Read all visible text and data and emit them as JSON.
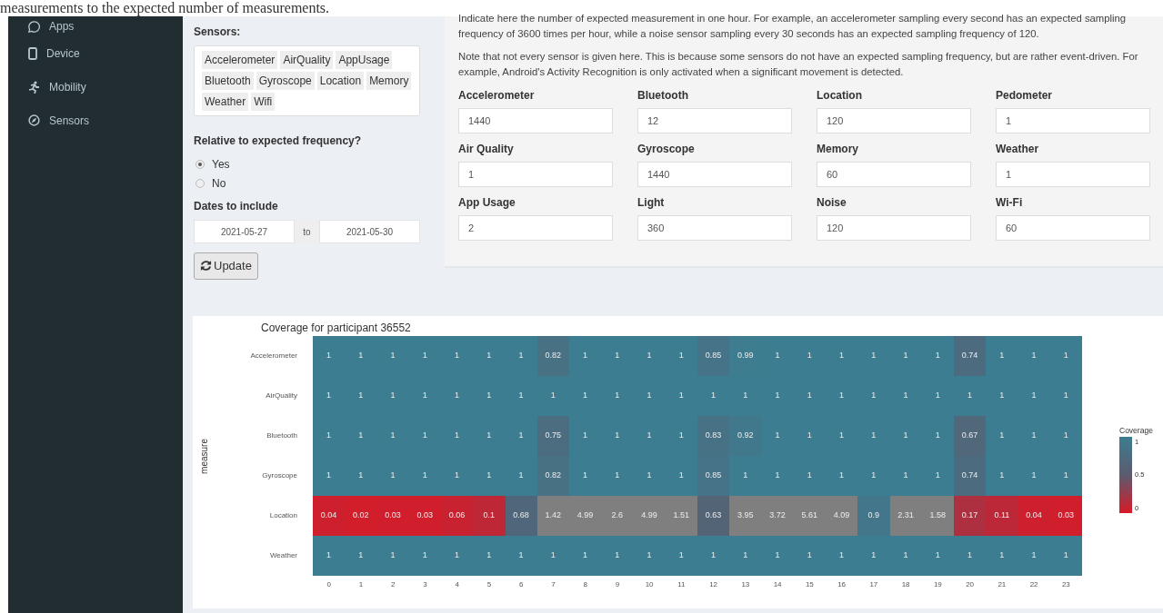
{
  "top_text": "measurements to the expected number of measurements.",
  "sidebar": {
    "items": [
      {
        "label": "Apps"
      },
      {
        "label": "Device"
      },
      {
        "label": "Mobility"
      },
      {
        "label": "Sensors"
      }
    ]
  },
  "filters": {
    "sensors_label": "Sensors:",
    "sensors": [
      "Accelerometer",
      "AirQuality",
      "AppUsage",
      "Bluetooth",
      "Gyroscope",
      "Location",
      "Memory",
      "Weather",
      "Wifi"
    ],
    "relative_label": "Relative to expected frequency?",
    "relative_options": [
      {
        "label": "Yes",
        "selected": true
      },
      {
        "label": "No",
        "selected": false
      }
    ],
    "dates_label": "Dates to include",
    "date_start": "2021-05-27",
    "date_separator": "to",
    "date_end": "2021-05-30",
    "update_button": "Update"
  },
  "frequency": {
    "paragraphs": [
      "Indicate here the number of expected measurement in one hour. For example, an accelerometer sampling every second has an expected sampling frequency of 3600 times per hour, while a noise sensor sampling every 30 seconds has an expected sampling frequency of 120.",
      "Note that not every sensor is given here. This is because some sensors do not have an expected sampling frequency, but are rather event-driven. For example, Android's Activity Recognition is only activated when a significant movement is detected."
    ],
    "fields": [
      {
        "label": "Accelerometer",
        "value": "1440"
      },
      {
        "label": "Bluetooth",
        "value": "12"
      },
      {
        "label": "Location",
        "value": "120"
      },
      {
        "label": "Pedometer",
        "value": "1"
      },
      {
        "label": "Air Quality",
        "value": "1"
      },
      {
        "label": "Gyroscope",
        "value": "1440"
      },
      {
        "label": "Memory",
        "value": "60"
      },
      {
        "label": "Weather",
        "value": "1"
      },
      {
        "label": "App Usage",
        "value": "2"
      },
      {
        "label": "Light",
        "value": "360"
      },
      {
        "label": "Noise",
        "value": "120"
      },
      {
        "label": "Wi-Fi",
        "value": "60"
      }
    ]
  },
  "heatmap": {
    "title": "Coverage for participant 36552",
    "ylabel": "measure",
    "legend_title": "Coverage",
    "legend_ticks": [
      "1",
      "0.5",
      "0"
    ],
    "x_axis_ticks": [
      "0",
      "1",
      "2",
      "3",
      "4",
      "5",
      "6",
      "7",
      "8",
      "9",
      "10",
      "11",
      "12",
      "13",
      "14",
      "15",
      "16",
      "17",
      "18",
      "19",
      "20",
      "21",
      "22",
      "23"
    ],
    "rows": [
      {
        "label": "Accelerometer",
        "cells": [
          "1",
          "1",
          "1",
          "1",
          "1",
          "1",
          "1",
          "0.82",
          "1",
          "1",
          "1",
          "1",
          "0.85",
          "0.99",
          "1",
          "1",
          "1",
          "1",
          "1",
          "1",
          "0.74",
          "1",
          "1",
          "1"
        ]
      },
      {
        "label": "AirQuality",
        "cells": [
          "1",
          "1",
          "1",
          "1",
          "1",
          "1",
          "1",
          "1",
          "1",
          "1",
          "1",
          "1",
          "1",
          "1",
          "1",
          "1",
          "1",
          "1",
          "1",
          "1",
          "1",
          "1",
          "1",
          "1"
        ]
      },
      {
        "label": "Bluetooth",
        "cells": [
          "1",
          "1",
          "1",
          "1",
          "1",
          "1",
          "1",
          "0.75",
          "1",
          "1",
          "1",
          "1",
          "0.83",
          "0.92",
          "1",
          "1",
          "1",
          "1",
          "1",
          "1",
          "0.67",
          "1",
          "1",
          "1"
        ]
      },
      {
        "label": "Gyroscope",
        "cells": [
          "1",
          "1",
          "1",
          "1",
          "1",
          "1",
          "1",
          "0.82",
          "1",
          "1",
          "1",
          "1",
          "0.85",
          "1",
          "1",
          "1",
          "1",
          "1",
          "1",
          "1",
          "0.74",
          "1",
          "1",
          "1"
        ]
      },
      {
        "label": "Location",
        "cells": [
          "0.04",
          "0.02",
          "0.03",
          "0.03",
          "0.06",
          "0.1",
          "0.68",
          "1.42",
          "4.99",
          "2.6",
          "4.99",
          "1.51",
          "0.63",
          "3.95",
          "3.72",
          "5.61",
          "4.09",
          "0.9",
          "2.31",
          "1.58",
          "0.17",
          "0.11",
          "0.04",
          "0.03"
        ]
      },
      {
        "label": "Weather",
        "cells": [
          "1",
          "1",
          "1",
          "1",
          "1",
          "1",
          "1",
          "1",
          "1",
          "1",
          "1",
          "1",
          "1",
          "1",
          "1",
          "1",
          "1",
          "1",
          "1",
          "1",
          "1",
          "1",
          "1",
          "1"
        ]
      }
    ]
  }
}
